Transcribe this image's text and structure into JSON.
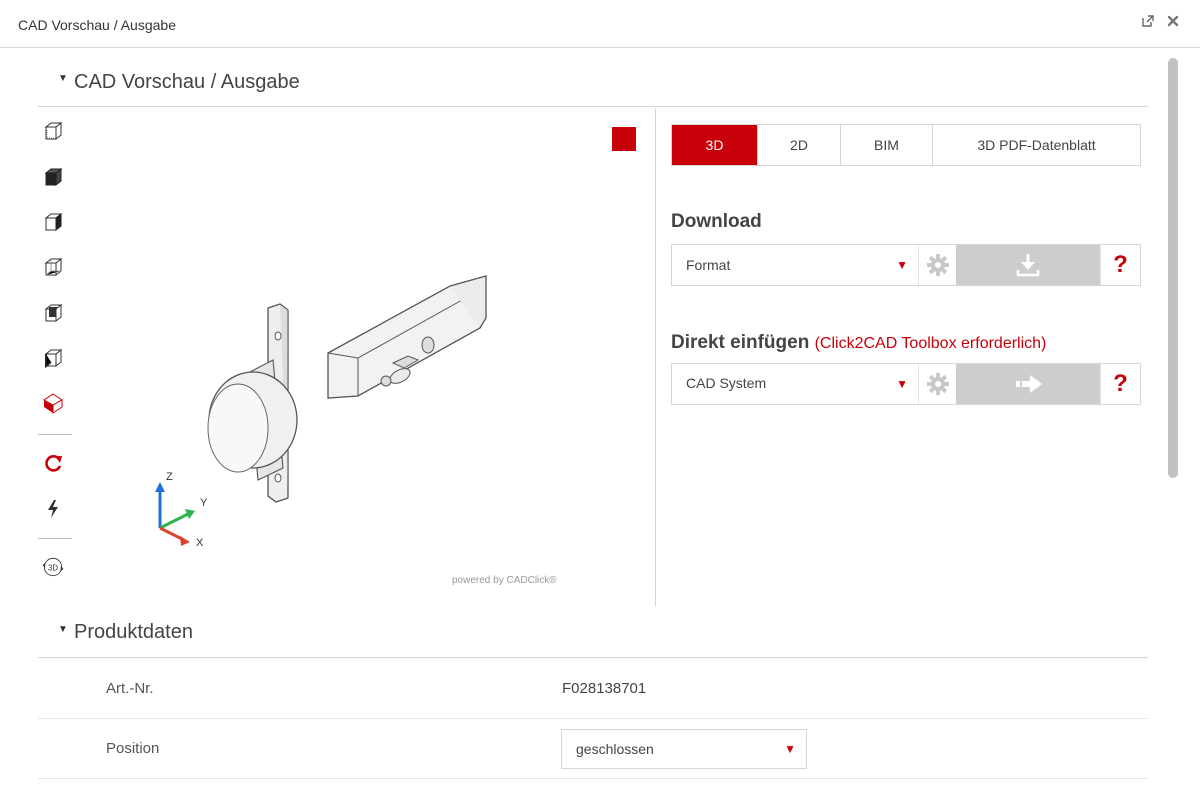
{
  "window": {
    "title": "CAD Vorschau / Ausgabe",
    "popout_icon": "external-link-icon",
    "close_icon": "close-icon"
  },
  "sections": {
    "cad": "CAD Vorschau / Ausgabe",
    "product": "Produktdaten"
  },
  "viewer": {
    "tools": [
      "view-front-icon",
      "shaded-icon",
      "view-side-icon",
      "wireframe-icon",
      "hidden-lines-icon",
      "view-back-icon",
      "color-icon",
      "rotate-icon",
      "fast-render-icon",
      "3d-toggle-icon"
    ],
    "badge_3d": "3D",
    "axis_labels": {
      "z": "Z",
      "y": "Y",
      "x": "X"
    },
    "powered_by": "powered by CADClick®",
    "accent": "#c8000a"
  },
  "tabs": [
    "3D",
    "2D",
    "BIM",
    "3D PDF-Datenblatt"
  ],
  "download": {
    "heading": "Download",
    "format_placeholder": "Format",
    "help": "?"
  },
  "direct": {
    "heading": "Direkt einfügen",
    "note": "(Click2CAD Toolbox erforderlich)",
    "system_placeholder": "CAD System",
    "help": "?"
  },
  "product": {
    "rows": [
      {
        "key": "Art.-Nr.",
        "value": "F028138701"
      },
      {
        "key": "Position",
        "value": "geschlossen"
      }
    ]
  }
}
